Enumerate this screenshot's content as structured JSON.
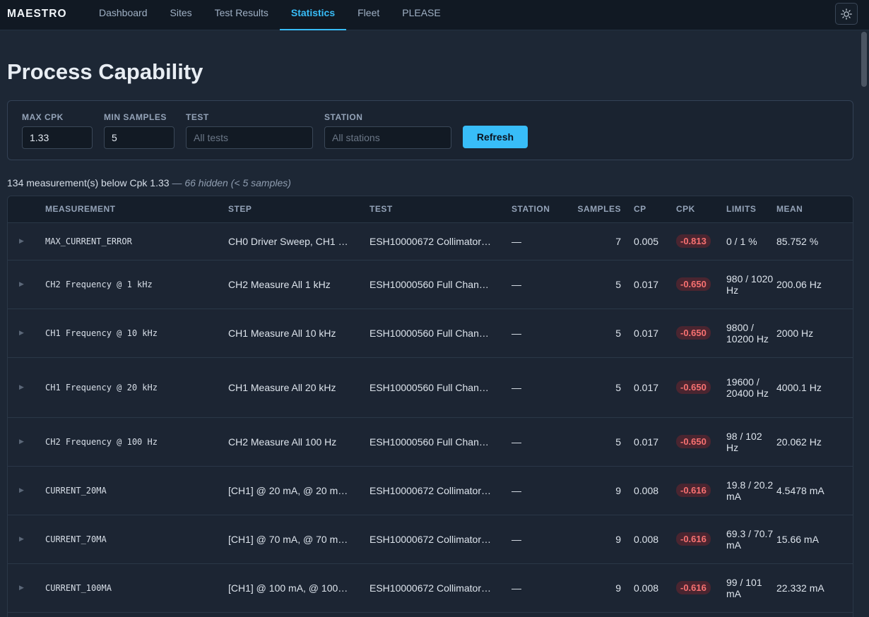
{
  "app": {
    "brand": "MAESTRO",
    "nav": [
      "Dashboard",
      "Sites",
      "Test Results",
      "Statistics",
      "Fleet",
      "PLEASE"
    ],
    "active_nav": "Statistics",
    "theme_icon": "sun-icon"
  },
  "page": {
    "title": "Process Capability"
  },
  "filters": {
    "max_cpk": {
      "label": "MAX CPK",
      "value": "1.33"
    },
    "min_samples": {
      "label": "MIN SAMPLES",
      "value": "5"
    },
    "test": {
      "label": "TEST",
      "value": "",
      "placeholder": "All tests"
    },
    "station": {
      "label": "STATION",
      "value": "",
      "placeholder": "All stations"
    },
    "refresh_label": "Refresh"
  },
  "summary": {
    "main": "134 measurement(s) below Cpk 1.33",
    "dash": " — ",
    "hidden": "66 hidden (< 5 samples)"
  },
  "colors": {
    "accent": "#38bdf8",
    "cpk_bad_text": "#f87171",
    "cpk_bad_bg": "#4a2530"
  },
  "table": {
    "columns": [
      "MEASUREMENT",
      "STEP",
      "TEST",
      "STATION",
      "SAMPLES",
      "CP",
      "CPK",
      "LIMITS",
      "MEAN"
    ],
    "rows": [
      {
        "measurement": "MAX_CURRENT_ERROR",
        "step": "CH0 Driver Sweep, CH1 …",
        "test": "ESH10000672 Collimator…",
        "station": "—",
        "samples": "7",
        "cp": "0.005",
        "cpk": "-0.813",
        "limits": "0 / 1 %",
        "mean": "85.752 %"
      },
      {
        "measurement": "CH2 Frequency @ 1 kHz",
        "step": "CH2 Measure All 1 kHz",
        "test": "ESH10000560 Full Chan…",
        "station": "—",
        "samples": "5",
        "cp": "0.017",
        "cpk": "-0.650",
        "limits": "980 / 1020 Hz",
        "mean": "200.06 Hz"
      },
      {
        "measurement": "CH1 Frequency @ 10 kHz",
        "step": "CH1 Measure All 10 kHz",
        "test": "ESH10000560 Full Chan…",
        "station": "—",
        "samples": "5",
        "cp": "0.017",
        "cpk": "-0.650",
        "limits": "9800 / 10200 Hz",
        "mean": "2000 Hz"
      },
      {
        "measurement": "CH1 Frequency @ 20 kHz",
        "step": "CH1 Measure All 20 kHz",
        "test": "ESH10000560 Full Chan…",
        "station": "—",
        "samples": "5",
        "cp": "0.017",
        "cpk": "-0.650",
        "limits": "19600 / 20400 Hz",
        "mean": "4000.1 Hz"
      },
      {
        "measurement": "CH2 Frequency @ 100 Hz",
        "step": "CH2 Measure All 100 Hz",
        "test": "ESH10000560 Full Chan…",
        "station": "—",
        "samples": "5",
        "cp": "0.017",
        "cpk": "-0.650",
        "limits": "98 / 102 Hz",
        "mean": "20.062 Hz"
      },
      {
        "measurement": "CURRENT_20MA",
        "step": "[CH1] @ 20 mA, @ 20 m…",
        "test": "ESH10000672 Collimator…",
        "station": "—",
        "samples": "9",
        "cp": "0.008",
        "cpk": "-0.616",
        "limits": "19.8 / 20.2 mA",
        "mean": "4.5478 mA"
      },
      {
        "measurement": "CURRENT_70MA",
        "step": "[CH1] @ 70 mA, @ 70 m…",
        "test": "ESH10000672 Collimator…",
        "station": "—",
        "samples": "9",
        "cp": "0.008",
        "cpk": "-0.616",
        "limits": "69.3 / 70.7 mA",
        "mean": "15.66 mA"
      },
      {
        "measurement": "CURRENT_100MA",
        "step": "[CH1] @ 100 mA, @ 100…",
        "test": "ESH10000672 Collimator…",
        "station": "—",
        "samples": "9",
        "cp": "0.008",
        "cpk": "-0.616",
        "limits": "99 / 101 mA",
        "mean": "22.332 mA"
      }
    ]
  }
}
